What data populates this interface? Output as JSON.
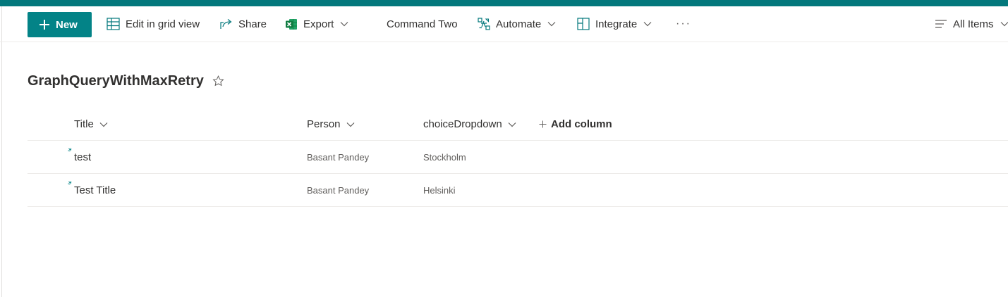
{
  "colors": {
    "accent": "#03787c",
    "button": "#038387",
    "text": "#323130",
    "secondary_text": "#605e5c"
  },
  "toolbar": {
    "new_label": "New",
    "new_icon": "plus-icon",
    "edit_grid_label": "Edit in grid view",
    "edit_grid_icon": "grid-icon",
    "share_label": "Share",
    "share_icon": "share-icon",
    "export_label": "Export",
    "export_icon": "excel-icon",
    "command_two_label": "Command Two",
    "automate_label": "Automate",
    "automate_icon": "flow-icon",
    "integrate_label": "Integrate",
    "integrate_icon": "integrate-icon",
    "more_label": "···",
    "view_label": "All Items",
    "view_icon": "lines-icon"
  },
  "page": {
    "title": "GraphQueryWithMaxRetry",
    "favorite_icon": "star-icon"
  },
  "list": {
    "columns": [
      {
        "label": "Title"
      },
      {
        "label": "Person"
      },
      {
        "label": "choiceDropdown"
      }
    ],
    "add_column_label": "Add column",
    "rows": [
      {
        "title": "test",
        "person": "Basant Pandey",
        "choice": "Stockholm",
        "badge_icon": "new-item-icon"
      },
      {
        "title": "Test Title",
        "person": "Basant Pandey",
        "choice": "Helsinki",
        "badge_icon": "new-item-icon"
      }
    ]
  }
}
